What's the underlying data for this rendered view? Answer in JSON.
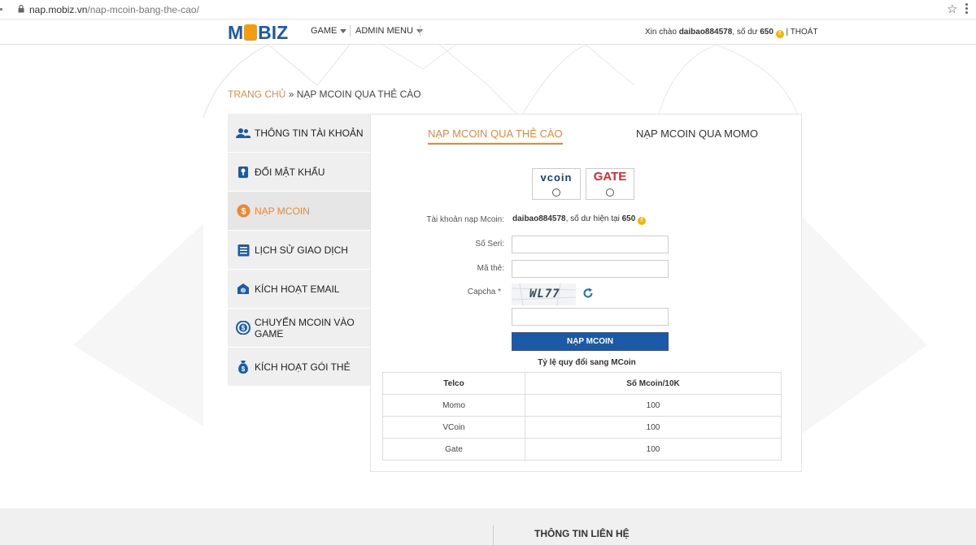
{
  "browser": {
    "url_domain": "nap.mobiz.vn",
    "url_path": "/nap-mcoin-bang-the-cao/"
  },
  "header": {
    "logo_left": "M",
    "logo_right": "BIZ",
    "nav": [
      {
        "label": "GAME"
      },
      {
        "label": "ADMIN MENU"
      }
    ],
    "greeting_prefix": "Xin chào",
    "username": "daibao884578",
    "balance_prefix": ", số dư",
    "balance": "650",
    "logout": "| THOÁT"
  },
  "breadcrumb": {
    "home": "TRANG CHỦ",
    "separator": "»",
    "current": "NẠP MCOIN QUA THẺ CÀO"
  },
  "sidebar": {
    "items": [
      {
        "label": "THÔNG TIN TÀI KHOẢN",
        "icon": "users-icon"
      },
      {
        "label": "ĐỔI MẬT KHẨU",
        "icon": "key-lock-icon"
      },
      {
        "label": "NẠP MCOIN",
        "icon": "dollar-circle-icon"
      },
      {
        "label": "LỊCH SỬ GIAO DỊCH",
        "icon": "list-icon"
      },
      {
        "label": "KÍCH HOẠT EMAIL",
        "icon": "email-icon"
      },
      {
        "label": "CHUYỂN MCOIN VÀO GAME",
        "icon": "transfer-icon"
      },
      {
        "label": "KÍCH HOẠT GÓI THẺ",
        "icon": "money-bag-icon"
      }
    ]
  },
  "tabs": [
    {
      "label": "NẠP MCOIN QUA THẺ CÀO",
      "active": true
    },
    {
      "label": "NẠP MCOIN QUA MOMO",
      "active": false
    }
  ],
  "providers": [
    {
      "name": "vcoin",
      "logo_text": "vcoin"
    },
    {
      "name": "gate",
      "logo_text": "GATE"
    }
  ],
  "form": {
    "account_label": "Tài khoản nạp Mcoin:",
    "account_user": "daibao884578",
    "account_balance_text": ", số dư hiện tại",
    "account_balance": "650",
    "serial_label": "Số Seri:",
    "serial_value": "",
    "card_label": "Mã thẻ:",
    "card_value": "",
    "captcha_label": "Capcha *",
    "captcha_text": "WL77",
    "captcha_value": "",
    "submit_label": "NẠP MCOIN"
  },
  "rates": {
    "title": "Tỷ lệ quy đổi sang MCoin",
    "headers": [
      "Telco",
      "Số Mcoin/10K"
    ],
    "rows": [
      [
        "Momo",
        "100"
      ],
      [
        "VCoin",
        "100"
      ],
      [
        "Gate",
        "100"
      ]
    ]
  },
  "footer": {
    "contact_title": "THÔNG TIN LIÊN HỆ"
  },
  "colors": {
    "accent": "#e8893a",
    "brand": "#1a5aa6",
    "coin": "#f5b400"
  }
}
